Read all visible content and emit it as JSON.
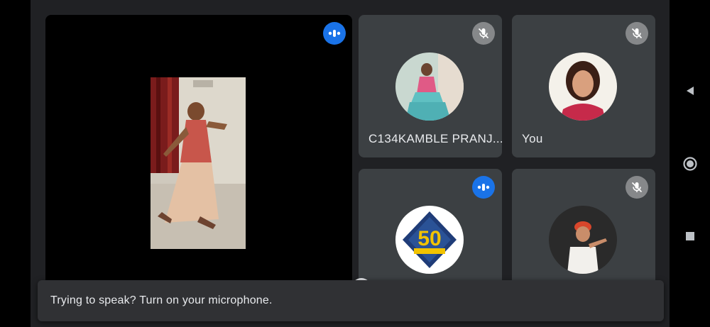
{
  "colors": {
    "background": "#202124",
    "tile": "#3c4043",
    "speaking_accent": "#1a73e8",
    "muted_badge": "#80868b",
    "text": "#e8eaed"
  },
  "main_tile": {
    "status_icon": "speaking-indicator-icon"
  },
  "participants": [
    {
      "name": "C134KAMBLE PRANJ...",
      "status_icon": "mic-off-icon"
    },
    {
      "name": "You",
      "status_icon": "mic-off-icon"
    },
    {
      "name": "",
      "status_icon": "speaking-indicator-icon"
    },
    {
      "name": "",
      "status_icon": "mic-off-icon"
    }
  ],
  "snackbar": {
    "message": "Trying to speak? Turn on your microphone."
  },
  "navbar": {
    "back_icon": "triangle-back-icon",
    "home_icon": "circle-home-icon",
    "recents_icon": "square-recents-icon"
  }
}
